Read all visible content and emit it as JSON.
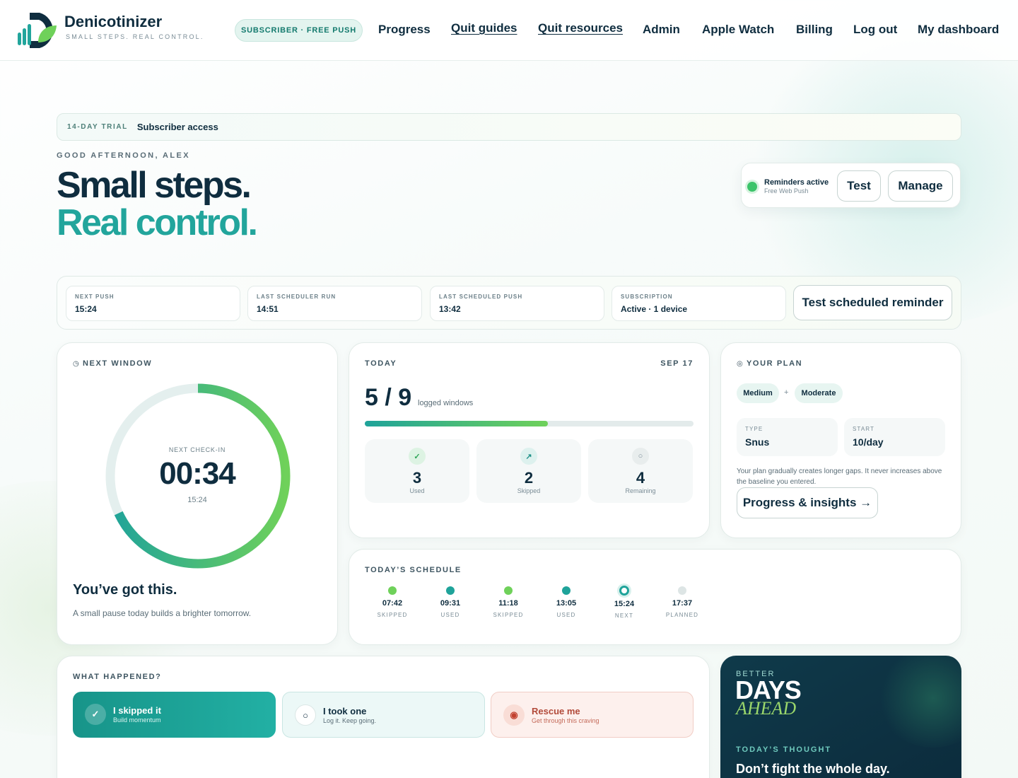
{
  "brand": {
    "name": "Denicotinizer",
    "tagline": "SMALL STEPS. REAL CONTROL."
  },
  "header": {
    "badge": "SUBSCRIBER · FREE PUSH",
    "nav": [
      "Progress",
      "Quit guides",
      "Quit resources",
      "Admin",
      "Apple Watch",
      "Billing",
      "Log out",
      "My dashboard"
    ]
  },
  "trial": {
    "label": "14-DAY TRIAL",
    "value": "Subscriber access"
  },
  "hero": {
    "greeting": "GOOD AFTERNOON, ALEX",
    "line1": "Small steps.",
    "line2": "Real control."
  },
  "reminders": {
    "status": "Reminders active",
    "sub": "Free Web Push",
    "test_label": "Test",
    "manage_label": "Manage"
  },
  "status_strip": {
    "items": [
      {
        "label": "NEXT PUSH",
        "value": "15:24"
      },
      {
        "label": "LAST SCHEDULER RUN",
        "value": "14:51"
      },
      {
        "label": "LAST SCHEDULED PUSH",
        "value": "13:42"
      },
      {
        "label": "SUBSCRIPTION",
        "value": "Active · 1 device"
      }
    ],
    "button": "Test scheduled reminder"
  },
  "next_window": {
    "title": "NEXT WINDOW",
    "caption": "NEXT CHECK-IN",
    "countdown": "00:34",
    "time": "15:24",
    "progress": 0.32,
    "heading": "You’ve got this.",
    "message": "A small pause today builds a brighter tomorrow."
  },
  "today": {
    "title": "TODAY",
    "date": "SEP 17",
    "logged": "5 / 9",
    "logged_caption": "logged windows",
    "progress": 0.556,
    "stats": [
      {
        "value": "3",
        "label": "Used",
        "icon": "check-icon"
      },
      {
        "value": "2",
        "label": "Skipped",
        "icon": "arrow-up-right-icon"
      },
      {
        "value": "4",
        "label": "Remaining",
        "icon": "circle-icon"
      }
    ]
  },
  "plan": {
    "title": "YOUR PLAN",
    "chips": [
      "Medium",
      "+",
      "Moderate"
    ],
    "type_label": "TYPE",
    "type_value": "Snus",
    "start_label": "START",
    "start_value": "10/day",
    "note": "Your plan gradually creates longer gaps. It never increases above the baseline you entered.",
    "button": "Progress & insights →"
  },
  "schedule": {
    "title": "TODAY’S SCHEDULE",
    "items": [
      {
        "time": "07:42",
        "status": "SKIPPED",
        "color": "#6fd15a"
      },
      {
        "time": "09:31",
        "status": "USED",
        "color": "#1fa39a"
      },
      {
        "time": "11:18",
        "status": "SKIPPED",
        "color": "#6fd15a"
      },
      {
        "time": "13:05",
        "status": "USED",
        "color": "#1fa39a"
      },
      {
        "time": "15:24",
        "status": "NEXT",
        "color": "#1fa39a"
      },
      {
        "time": "17:37",
        "status": "PLANNED",
        "color": "#dde5e5"
      }
    ]
  },
  "what_happened": {
    "title": "WHAT HAPPENED?",
    "actions": [
      {
        "title": "I skipped it",
        "sub": "Build momentum"
      },
      {
        "title": "I took one",
        "sub": "Log it. Keep going."
      },
      {
        "title": "Rescue me",
        "sub": "Get through this craving"
      }
    ]
  },
  "promo": {
    "small": "BETTER",
    "big": "DAYS",
    "italic": "AHEAD",
    "thought_label": "TODAY’S THOUGHT",
    "thought": "Don’t fight the whole day."
  },
  "colors": {
    "teal": "#22a59c",
    "green": "#6fd15a",
    "navy": "#0f2d3f",
    "rescue": "#b24a3a"
  }
}
